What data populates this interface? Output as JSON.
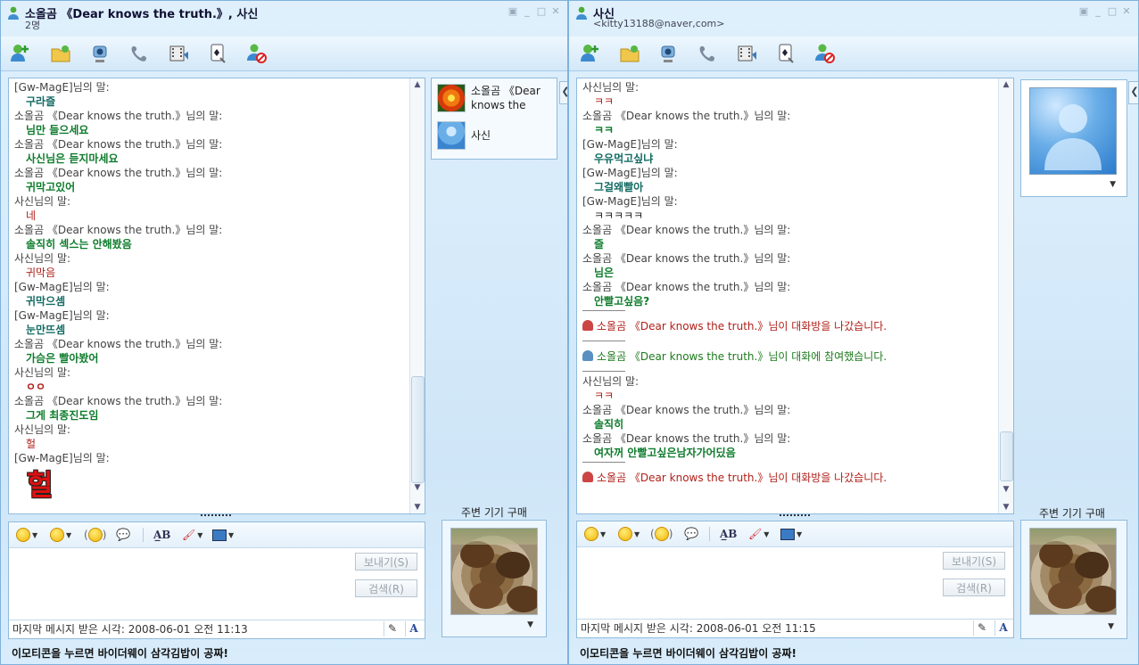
{
  "window1": {
    "title": "소올곰 《Dear knows the truth.》, 사신",
    "subtitle": "2명",
    "messages": [
      {
        "kind": "h",
        "text": "[Gw-MagE]님의 말:"
      },
      {
        "kind": "t",
        "color": "teal",
        "text": "구라즐"
      },
      {
        "kind": "h",
        "text": "소올곰 《Dear knows the truth.》님의 말:"
      },
      {
        "kind": "t",
        "color": "green",
        "text": "님만 들으세요"
      },
      {
        "kind": "h",
        "text": "소올곰 《Dear knows the truth.》님의 말:"
      },
      {
        "kind": "t",
        "color": "green",
        "text": "사신님은 듣지마세요"
      },
      {
        "kind": "h",
        "text": "소올곰 《Dear knows the truth.》님의 말:"
      },
      {
        "kind": "t",
        "color": "green",
        "text": "귀막고있어"
      },
      {
        "kind": "h",
        "text": "사신님의 말:"
      },
      {
        "kind": "t",
        "color": "red",
        "text": "네"
      },
      {
        "kind": "h",
        "text": "소올곰 《Dear knows the truth.》님의 말:"
      },
      {
        "kind": "t",
        "color": "green",
        "text": "솔직히 섹스는 안해봤음"
      },
      {
        "kind": "h",
        "text": "사신님의 말:"
      },
      {
        "kind": "t",
        "color": "red",
        "text": "귀막음"
      },
      {
        "kind": "h",
        "text": "[Gw-MagE]님의 말:"
      },
      {
        "kind": "t",
        "color": "teal",
        "text": "귀막으셈"
      },
      {
        "kind": "h",
        "text": "[Gw-MagE]님의 말:"
      },
      {
        "kind": "t",
        "color": "teal",
        "text": "눈만뜨셈"
      },
      {
        "kind": "h",
        "text": "소올곰 《Dear knows the truth.》님의 말:"
      },
      {
        "kind": "t",
        "color": "green",
        "text": "가슴은 빨아봤어"
      },
      {
        "kind": "h",
        "text": "사신님의 말:"
      },
      {
        "kind": "t",
        "color": "red b",
        "text": "ㅇㅇ"
      },
      {
        "kind": "h",
        "text": "소올곰 《Dear knows the truth.》님의 말:"
      },
      {
        "kind": "t",
        "color": "green",
        "text": "그게 최종진도임"
      },
      {
        "kind": "h",
        "text": "사신님의 말:"
      },
      {
        "kind": "t",
        "color": "red",
        "text": "헐"
      },
      {
        "kind": "h",
        "text": "[Gw-MagE]님의 말:"
      },
      {
        "kind": "big",
        "text": "헐"
      }
    ],
    "participants": [
      {
        "name": "소올곰 《Dear knows the",
        "icon": "flower-avatar-icon"
      },
      {
        "name": "사신",
        "icon": "person-avatar-icon"
      }
    ],
    "status": "마지막 메시지 받은 시각: 2008-06-01 오전 11:13"
  },
  "window2": {
    "title": "사신",
    "subtitle": "<kitty13188@naver,com>",
    "messages": [
      {
        "kind": "h",
        "text": "사신님의 말:"
      },
      {
        "kind": "t",
        "color": "red",
        "text": "ㅋㅋ"
      },
      {
        "kind": "h",
        "text": "소올곰 《Dear knows the truth.》님의 말:"
      },
      {
        "kind": "t",
        "color": "green",
        "text": "ㅋㅋ"
      },
      {
        "kind": "h",
        "text": "[Gw-MagE]님의 말:"
      },
      {
        "kind": "t",
        "color": "teal",
        "text": "우유먹고싶냐"
      },
      {
        "kind": "h",
        "text": "[Gw-MagE]님의 말:"
      },
      {
        "kind": "t",
        "color": "teal",
        "text": "그걸왜빨아"
      },
      {
        "kind": "h",
        "text": "[Gw-MagE]님의 말:"
      },
      {
        "kind": "t",
        "color": "dark",
        "text": "ㅋㅋㅋㅋㅋ"
      },
      {
        "kind": "h",
        "text": "소올곰 《Dear knows the truth.》님의 말:"
      },
      {
        "kind": "t",
        "color": "green",
        "text": "즐"
      },
      {
        "kind": "h",
        "text": "소올곰 《Dear knows the truth.》님의 말:"
      },
      {
        "kind": "t",
        "color": "green",
        "text": "님은"
      },
      {
        "kind": "h",
        "text": "소올곰 《Dear knows the truth.》님의 말:"
      },
      {
        "kind": "t",
        "color": "green",
        "text": "안빨고싶음?"
      },
      {
        "kind": "sep",
        "text": ""
      },
      {
        "kind": "sys",
        "text": "소올곰 《Dear knows the truth.》님이 대화방을 나갔습니다."
      },
      {
        "kind": "sep",
        "text": ""
      },
      {
        "kind": "sysj",
        "text": "소올곰 《Dear knows the truth.》님이 대화에 참여했습니다."
      },
      {
        "kind": "sep",
        "text": ""
      },
      {
        "kind": "h",
        "text": "사신님의 말:"
      },
      {
        "kind": "t",
        "color": "red",
        "text": "ㅋㅋ"
      },
      {
        "kind": "h",
        "text": "소올곰 《Dear knows the truth.》님의 말:"
      },
      {
        "kind": "t",
        "color": "green",
        "text": "솔직히"
      },
      {
        "kind": "h",
        "text": "소올곰 《Dear knows the truth.》님의 말:"
      },
      {
        "kind": "t",
        "color": "green",
        "text": "여자꺼 안빨고싶은남자가어딨음"
      },
      {
        "kind": "sep",
        "text": ""
      },
      {
        "kind": "sys",
        "text": "소올곰 《Dear knows the truth.》님이 대화방을 나갔습니다."
      }
    ],
    "status": "마지막 메시지 받은 시각: 2008-06-01 오전 11:15"
  },
  "common": {
    "send_label": "보내기(S)",
    "search_label": "검색(R)",
    "market_label": "주변 기기 구매",
    "bottom_ad": "이모티콘을 누르면 바이더웨이 삼각김밥이 공짜!",
    "font_button": "A",
    "toolbar_icons": [
      "invite-icon",
      "send-file-icon",
      "webcam-icon",
      "voice-call-icon",
      "video-icon",
      "game-icon",
      "block-icon"
    ]
  },
  "colors": {
    "green": "#0e7c2c",
    "red": "#b0201a",
    "teal": "#136b63",
    "accent": "#7fb2dc"
  }
}
